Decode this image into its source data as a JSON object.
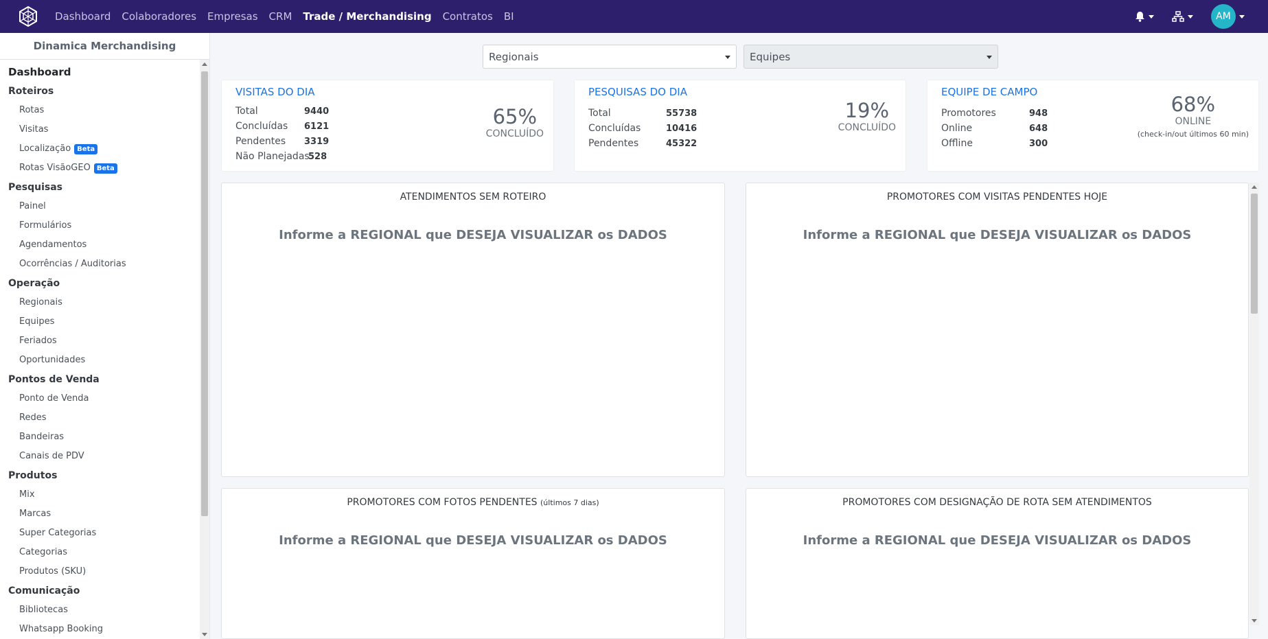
{
  "navbar": {
    "links": [
      "Dashboard",
      "Colaboradores",
      "Empresas",
      "CRM",
      "Trade / Merchandising",
      "Contratos",
      "BI"
    ],
    "active_link": "Trade / Merchandising",
    "avatar_initials": "AM"
  },
  "sidebar": {
    "brand": "Dinamica Merchandising",
    "top_item": "Dashboard",
    "sections": [
      {
        "title": "Roteiros",
        "items": [
          {
            "label": "Rotas"
          },
          {
            "label": "Visitas"
          },
          {
            "label": "Localização",
            "badge": "Beta"
          },
          {
            "label": "Rotas VisãoGEO",
            "badge": "Beta"
          }
        ]
      },
      {
        "title": "Pesquisas",
        "items": [
          {
            "label": "Painel"
          },
          {
            "label": "Formulários"
          },
          {
            "label": "Agendamentos"
          },
          {
            "label": "Ocorrências / Auditorias"
          }
        ]
      },
      {
        "title": "Operação",
        "items": [
          {
            "label": "Regionais"
          },
          {
            "label": "Equipes"
          },
          {
            "label": "Feriados"
          },
          {
            "label": "Oportunidades"
          }
        ]
      },
      {
        "title": "Pontos de Venda",
        "items": [
          {
            "label": "Ponto de Venda"
          },
          {
            "label": "Redes"
          },
          {
            "label": "Bandeiras"
          },
          {
            "label": "Canais de PDV"
          }
        ]
      },
      {
        "title": "Produtos",
        "items": [
          {
            "label": "Mix"
          },
          {
            "label": "Marcas"
          },
          {
            "label": "Super Categorias"
          },
          {
            "label": "Categorias"
          },
          {
            "label": "Produtos (SKU)"
          }
        ]
      },
      {
        "title": "Comunicação",
        "items": [
          {
            "label": "Bibliotecas"
          },
          {
            "label": "Whatsapp Booking"
          }
        ]
      }
    ]
  },
  "filters": {
    "regionais": "Regionais",
    "equipes": "Equipes"
  },
  "stats": {
    "visitas": {
      "title": "VISITAS DO DIA",
      "rows": [
        {
          "label": "Total",
          "value": "9440"
        },
        {
          "label": "Concluídas",
          "value": "6121"
        },
        {
          "label": "Pendentes",
          "value": "3319"
        },
        {
          "label": "Não Planejadas",
          "value": "528"
        }
      ],
      "percent": "65%",
      "percent_label": "CONCLUÍDO"
    },
    "pesquisas": {
      "title": "PESQUISAS DO DIA",
      "rows": [
        {
          "label": "Total",
          "value": "55738"
        },
        {
          "label": "Concluídas",
          "value": "10416"
        },
        {
          "label": "Pendentes",
          "value": "45322"
        }
      ],
      "percent": "19%",
      "percent_label": "CONCLUÍDO"
    },
    "equipe": {
      "title": "EQUIPE DE CAMPO",
      "rows": [
        {
          "label": "Promotores",
          "value": "948"
        },
        {
          "label": "Online",
          "value": "648"
        },
        {
          "label": "Offline",
          "value": "300"
        }
      ],
      "percent": "68%",
      "percent_label": "ONLINE",
      "note": "(check-in/out últimos 60 min)"
    }
  },
  "panels": {
    "message": "Informe a REGIONAL que DESEJA VISUALIZAR os DADOS",
    "atendimentos_sem_roteiro": "ATENDIMENTOS SEM ROTEIRO",
    "visitas_pendentes": "PROMOTORES COM VISITAS PENDENTES HOJE",
    "fotos_pendentes": "PROMOTORES COM FOTOS PENDENTES",
    "fotos_pendentes_small": "(últimos 7 dias)",
    "rota_sem_atendimentos": "PROMOTORES COM DESIGNAÇÃO DE ROTA SEM ATENDIMENTOS"
  },
  "colors": {
    "navbar": "#2d1f6b",
    "accent": "#1a73e8",
    "avatar": "#25b5c8"
  }
}
